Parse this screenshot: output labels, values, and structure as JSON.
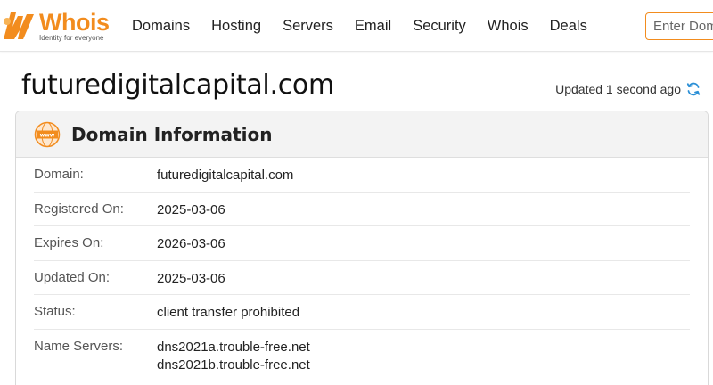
{
  "header": {
    "logo_word": "Whois",
    "logo_tagline": "Identity for everyone",
    "nav": [
      "Domains",
      "Hosting",
      "Servers",
      "Email",
      "Security",
      "Whois",
      "Deals"
    ],
    "search_placeholder": "Enter Domain or IP"
  },
  "page": {
    "domain": "futuredigitalcapital.com",
    "updated_text": "Updated 1 second ago"
  },
  "domain_info": {
    "title": "Domain Information",
    "rows": [
      {
        "label": "Domain:",
        "value": "futuredigitalcapital.com"
      },
      {
        "label": "Registered On:",
        "value": "2025-03-06"
      },
      {
        "label": "Expires On:",
        "value": "2026-03-06"
      },
      {
        "label": "Updated On:",
        "value": "2025-03-06"
      },
      {
        "label": "Status:",
        "value": "client transfer prohibited"
      }
    ],
    "name_servers_label": "Name Servers:",
    "name_servers": [
      "dns2021a.trouble-free.net",
      "dns2021b.trouble-free.net"
    ]
  },
  "colors": {
    "brand": "#f28c1e",
    "refresh": "#2a8fd6"
  },
  "icons": {
    "logo": "whois-logo-icon",
    "www": "www-globe-icon",
    "refresh": "refresh-icon"
  }
}
